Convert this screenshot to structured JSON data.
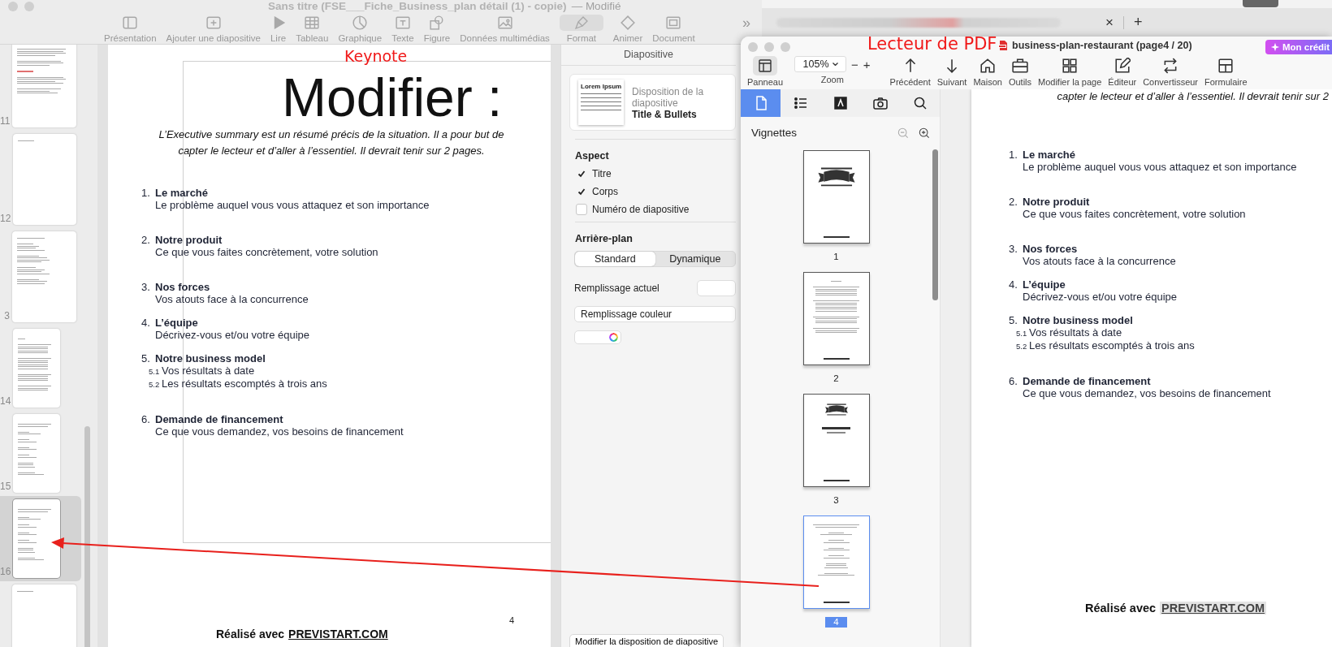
{
  "keynote": {
    "title": "Sans titre (FSE___Fiche_Business_plan détail (1) - copie)",
    "edited": "— Modifié",
    "toolbar": [
      {
        "label": "Présentation",
        "selected": false
      },
      {
        "label": "Ajouter une diapositive",
        "selected": false
      },
      {
        "label": "Lire",
        "selected": false
      },
      {
        "label": "Tableau",
        "selected": false
      },
      {
        "label": "Graphique",
        "selected": false
      },
      {
        "label": "Texte",
        "selected": false
      },
      {
        "label": "Figure",
        "selected": false
      },
      {
        "label": "Données multimédias",
        "selected": false
      },
      {
        "label": "Format",
        "selected": true
      },
      {
        "label": "Animer",
        "selected": false
      },
      {
        "label": "Document",
        "selected": false
      }
    ],
    "overflow": "»",
    "slides": [
      {
        "number": "11",
        "kind": "text",
        "selected": false
      },
      {
        "number": "12",
        "kind": "blank",
        "selected": false
      },
      {
        "number": "3",
        "kind": "list",
        "selected": false
      },
      {
        "number": "14",
        "kind": "contents",
        "selected": false
      },
      {
        "number": "15",
        "kind": "summary",
        "selected": false
      },
      {
        "number": "16",
        "kind": "summary",
        "selected": true
      },
      {
        "kind": "blank",
        "selected": false
      }
    ],
    "slide": {
      "title": "Modifier :",
      "intro_lines": [
        "L’Executive summary  est un résumé précis de la situation. Il a pour but de",
        "capter le lecteur et d’aller à l’essentiel. Il devrait tenir sur 2 pages."
      ],
      "items": [
        {
          "number": "1.",
          "heading": "Le marché",
          "text": "Le problème auquel vous vous attaquez et son importance"
        },
        {
          "number": "2.",
          "heading": "Notre produit",
          "text": "Ce que vous faites concrètement, votre solution"
        },
        {
          "number": "3.",
          "heading": "Nos forces",
          "text": "Vos atouts face à la concurrence"
        },
        {
          "number": "4.",
          "heading": "L’équipe",
          "text": "Décrivez-vous et/ou votre équipe"
        },
        {
          "number": "5.",
          "heading": "Notre business model",
          "children": [
            {
              "number": "5.1",
              "text": "Vos résultats à date"
            },
            {
              "number": "5.2",
              "text": "Les résultats escomptés à trois ans"
            }
          ]
        },
        {
          "number": "6.",
          "heading": "Demande de financement",
          "text": "Ce que vous demandez, vos besoins de financement"
        }
      ],
      "page_number": "4",
      "footer_prefix": "Réalisé avec",
      "footer_brand": "PREVISTART.COM"
    },
    "inspector": {
      "header": "Diapositive",
      "preview_title": "Lorem Ipsum",
      "layout_label": "Disposition de la diapositive",
      "layout_name": "Title & Bullets",
      "appearance_label": "Aspect",
      "options": [
        {
          "label": "Titre",
          "checked": true
        },
        {
          "label": "Corps",
          "checked": true
        },
        {
          "label": "Numéro de diapositive",
          "checked": false
        }
      ],
      "background_label": "Arrière-plan",
      "segments": [
        {
          "label": "Standard",
          "selected": true
        },
        {
          "label": "Dynamique",
          "selected": false
        }
      ],
      "current_fill_label": "Remplissage actuel",
      "fill_type": "Remplissage couleur",
      "bottom_button": "Modifier la disposition de diapositive"
    }
  },
  "browser": {
    "close": "×",
    "new_tab": "+"
  },
  "annotations": {
    "keynote": "Keynote",
    "pdf_reader": "Lecteur de PDF"
  },
  "pdf_reader": {
    "document": "business-plan-restaurant (page4 / 20)",
    "credit": "Mon crédit",
    "panel_button": {
      "label": "Panneau",
      "selected": true
    },
    "zoom": {
      "value": "105%",
      "label": "Zoom",
      "minus": "−",
      "plus": "+"
    },
    "tools": [
      {
        "label": "Précédent"
      },
      {
        "label": "Suivant"
      },
      {
        "label": "Maison"
      },
      {
        "label": "Outils"
      },
      {
        "label": "Modifier la page"
      },
      {
        "label": "Éditeur"
      },
      {
        "label": "Convertisseur"
      },
      {
        "label": "Formulaire"
      }
    ],
    "sidebar_tabs": [
      {
        "selected": true
      },
      {
        "selected": false
      },
      {
        "selected": false
      },
      {
        "selected": false
      },
      {
        "selected": false
      }
    ],
    "thumbnails_title": "Vignettes",
    "pages": [
      {
        "label": "1",
        "kind": "cover",
        "selected": false
      },
      {
        "label": "2",
        "kind": "contents",
        "selected": false
      },
      {
        "label": "3",
        "kind": "title",
        "selected": false
      },
      {
        "label": "4",
        "kind": "summary",
        "selected": true
      }
    ],
    "page": {
      "intro": "capter le lecteur et d’aller à l’essentiel. Il devrait tenir sur 2",
      "items": [
        {
          "number": "1.",
          "heading": "Le marché",
          "text": "Le problème auquel vous vous attaquez et son importance"
        },
        {
          "number": "2.",
          "heading": "Notre produit",
          "text": "Ce que vous faites concrètement, votre solution"
        },
        {
          "number": "3.",
          "heading": "Nos forces",
          "text": "Vos atouts face à la concurrence"
        },
        {
          "number": "4.",
          "heading": "L’équipe",
          "text": "Décrivez-vous et/ou votre équipe"
        },
        {
          "number": "5.",
          "heading": "Notre business model",
          "children": [
            {
              "number": "5.1",
              "text": "Vos résultats à date"
            },
            {
              "number": "5.2",
              "text": "Les résultats escomptés à trois ans"
            }
          ]
        },
        {
          "number": "6.",
          "heading": "Demande de financement",
          "text": "Ce que vous demandez, vos besoins de financement"
        }
      ],
      "footer_prefix": "Réalisé avec",
      "footer_brand": "PREVISTART.COM"
    }
  }
}
